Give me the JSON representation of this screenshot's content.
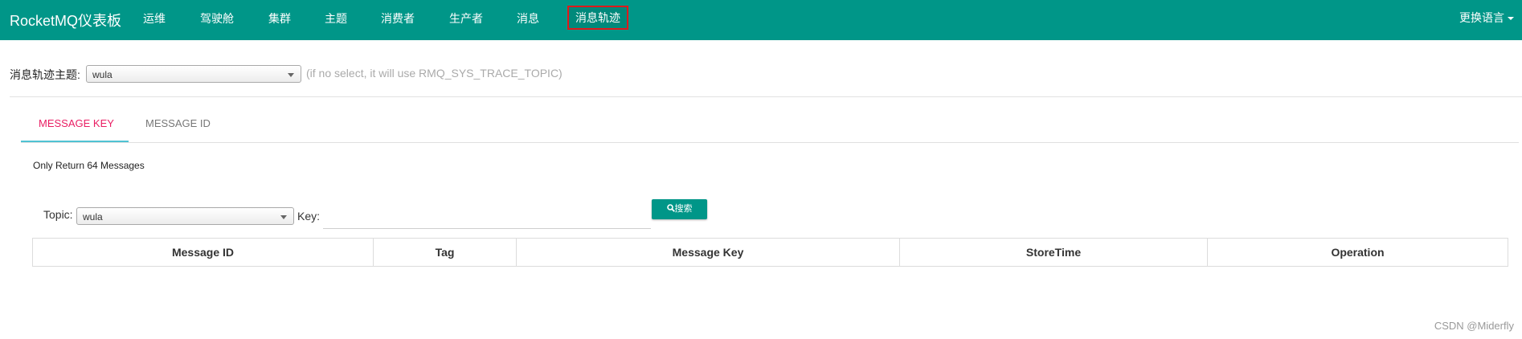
{
  "navbar": {
    "brand": "RocketMQ仪表板",
    "items": [
      "运维",
      "驾驶舱",
      "集群",
      "主题",
      "消费者",
      "生产者",
      "消息"
    ],
    "active_item": "消息轨迹",
    "language_label": "更换语言",
    "background_color": "#009688",
    "active_border_color": "#e0191b"
  },
  "trace_topic": {
    "label": "消息轨迹主题:",
    "selected": "wula",
    "hint": "(if no select, it will use RMQ_SYS_TRACE_TOPIC)"
  },
  "tabs": {
    "items": [
      "MESSAGE KEY",
      "MESSAGE ID"
    ],
    "active": "MESSAGE KEY",
    "active_color": "#e91e63"
  },
  "info_text": "Only Return 64 Messages",
  "search": {
    "topic_label": "Topic:",
    "topic_selected": "wula",
    "key_label": "Key:",
    "key_value": "",
    "button_label": "搜索",
    "button_icon": "search-icon"
  },
  "table": {
    "columns": [
      "Message ID",
      "Tag",
      "Message Key",
      "StoreTime",
      "Operation"
    ],
    "rows": []
  },
  "watermark": "CSDN @Miderfly"
}
